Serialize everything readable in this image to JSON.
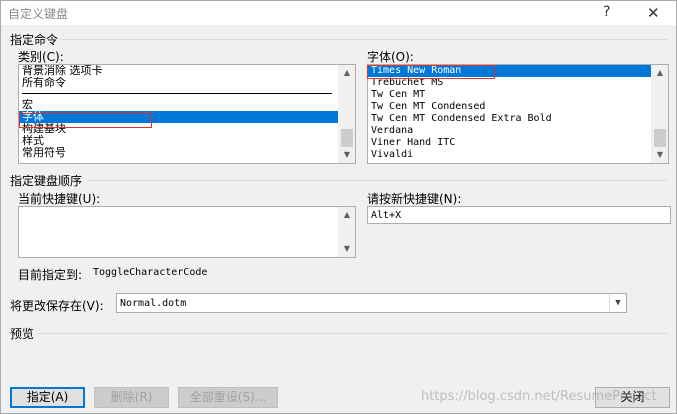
{
  "window": {
    "title": "自定义键盘",
    "help_label": "?",
    "close_label": "✕"
  },
  "specify_command": {
    "section_label": "指定命令",
    "categories_label": "类别(C):",
    "categories": [
      {
        "label": "背景消除 选项卡",
        "selected": false
      },
      {
        "label": "所有命令",
        "selected": false
      },
      {
        "label": "",
        "divider": true
      },
      {
        "label": "宏",
        "selected": false
      },
      {
        "label": "字体",
        "selected": true
      },
      {
        "label": "构建基块",
        "selected": false
      },
      {
        "label": "样式",
        "selected": false
      },
      {
        "label": "常用符号",
        "selected": false
      }
    ],
    "fonts_label": "字体(O):",
    "fonts": [
      {
        "label": "Times New Roman",
        "selected": true
      },
      {
        "label": "Trebuchet MS",
        "selected": false
      },
      {
        "label": "Tw Cen MT",
        "selected": false
      },
      {
        "label": "Tw Cen MT Condensed",
        "selected": false
      },
      {
        "label": "Tw Cen MT Condensed Extra Bold",
        "selected": false
      },
      {
        "label": "Verdana",
        "selected": false
      },
      {
        "label": "Viner Hand ITC",
        "selected": false
      },
      {
        "label": "Vivaldi",
        "selected": false
      }
    ]
  },
  "key_sequence": {
    "section_label": "指定键盘顺序",
    "current_keys_label": "当前快捷键(U):",
    "current_keys": [],
    "new_key_label": "请按新快捷键(N):",
    "new_key_value": "Alt+X",
    "assigned_to_label": "目前指定到:",
    "assigned_to_value": "ToggleCharacterCode"
  },
  "save_changes": {
    "label": "将更改保存在(V):",
    "value": "Normal.dotm"
  },
  "preview": {
    "label": "预览"
  },
  "buttons": {
    "assign": "指定(A)",
    "remove": "删除(R)",
    "reset_all": "全部重设(S)...",
    "close": "关闭"
  },
  "watermark": "https://blog.csdn.net/ResumeProject",
  "colors": {
    "selection": "#0078d7",
    "highlight_box": "#e03030",
    "background": "#f0f0f0"
  }
}
